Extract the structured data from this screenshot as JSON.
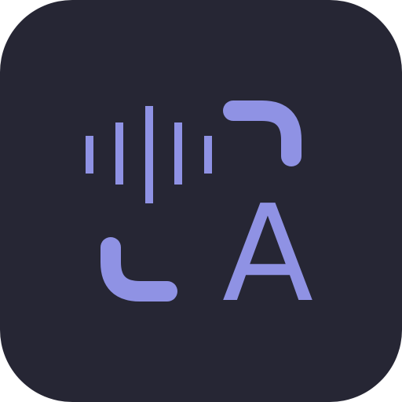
{
  "icon": {
    "name": "speech-to-text-app-icon",
    "glyph": "A",
    "colors": {
      "background": "#262634",
      "accent": "#8f92e4"
    }
  }
}
